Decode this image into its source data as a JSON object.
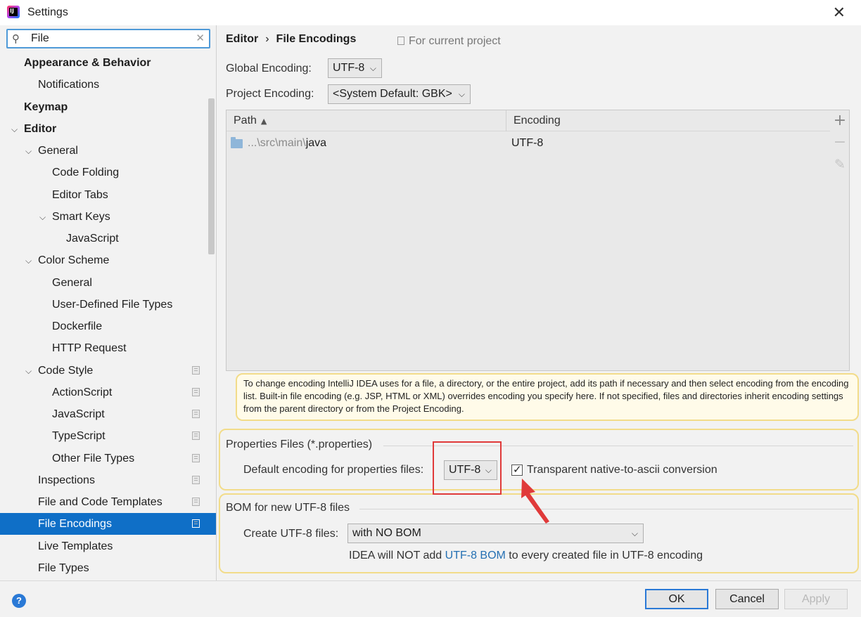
{
  "window": {
    "title": "Settings",
    "close_icon": "close-icon"
  },
  "sidebar": {
    "search_value": "File",
    "items": [
      {
        "label": "Appearance & Behavior",
        "level": 0,
        "bold": true
      },
      {
        "label": "Notifications",
        "level": 1
      },
      {
        "label": "Keymap",
        "level": 0,
        "bold": true
      },
      {
        "label": "Editor",
        "level": 0,
        "bold": true,
        "expanded": true
      },
      {
        "label": "General",
        "level": 1,
        "expanded": true
      },
      {
        "label": "Code Folding",
        "level": 2
      },
      {
        "label": "Editor Tabs",
        "level": 2
      },
      {
        "label": "Smart Keys",
        "level": 2,
        "expanded": true
      },
      {
        "label": "JavaScript",
        "level": 3
      },
      {
        "label": "Color Scheme",
        "level": 1,
        "expanded": true
      },
      {
        "label": "General",
        "level": 2
      },
      {
        "label": "User-Defined File Types",
        "level": 2
      },
      {
        "label": "Dockerfile",
        "level": 2
      },
      {
        "label": "HTTP Request",
        "level": 2
      },
      {
        "label": "Code Style",
        "level": 1,
        "expanded": true,
        "project": true
      },
      {
        "label": "ActionScript",
        "level": 2,
        "project": true
      },
      {
        "label": "JavaScript",
        "level": 2,
        "project": true
      },
      {
        "label": "TypeScript",
        "level": 2,
        "project": true
      },
      {
        "label": "Other File Types",
        "level": 2,
        "project": true
      },
      {
        "label": "Inspections",
        "level": 1,
        "project": true
      },
      {
        "label": "File and Code Templates",
        "level": 1,
        "project": true
      },
      {
        "label": "File Encodings",
        "level": 1,
        "project": true,
        "selected": true
      },
      {
        "label": "Live Templates",
        "level": 1
      },
      {
        "label": "File Types",
        "level": 1
      }
    ]
  },
  "main": {
    "breadcrumb": {
      "parent": "Editor",
      "separator": "›",
      "current": "File Encodings"
    },
    "for_current_project": "For current project",
    "global_encoding": {
      "label": "Global Encoding:",
      "value": "UTF-8"
    },
    "project_encoding": {
      "label": "Project Encoding:",
      "value": "<System Default: GBK>"
    },
    "table": {
      "columns": [
        "Path",
        "Encoding"
      ],
      "rows": [
        {
          "path_prefix": "...\\src\\main\\",
          "path_tail": "java",
          "encoding": "UTF-8"
        }
      ],
      "tools": {
        "add": "+",
        "remove": "−",
        "edit": "✎"
      }
    },
    "note": "To change encoding IntelliJ IDEA uses for a file, a directory, or the entire project, add its path if necessary and then select encoding from the encoding list. Built-in file encoding (e.g. JSP, HTML or XML) overrides encoding you specify here. If not specified, files and directories inherit encoding settings from the parent directory or from the Project Encoding.",
    "properties": {
      "title": "Properties Files (*.properties)",
      "default_label": "Default encoding for properties files:",
      "default_value": "UTF-8",
      "transparent_label": "Transparent native-to-ascii conversion",
      "transparent_checked": true
    },
    "bom": {
      "title": "BOM for new UTF-8 files",
      "create_label": "Create UTF-8 files:",
      "create_value": "with NO BOM",
      "info_pre": "IDEA will NOT add ",
      "info_link": "UTF-8 BOM",
      "info_post": " to every created file in UTF-8 encoding"
    }
  },
  "footer": {
    "help": "?",
    "ok": "OK",
    "cancel": "Cancel",
    "apply": "Apply"
  },
  "colors": {
    "selection": "#0f6fc7",
    "highlight_box": "#e03a3a",
    "note_border": "#f2dc8a",
    "link": "#2470b3"
  }
}
